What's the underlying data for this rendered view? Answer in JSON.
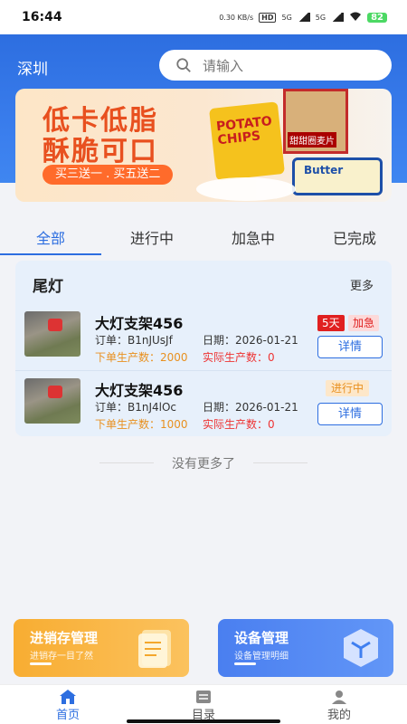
{
  "status_bar": {
    "time": "16:44",
    "speed": "0.30 KB/s",
    "hd": "HD",
    "net1": "5G",
    "net2": "5G",
    "battery": "82"
  },
  "header": {
    "city": "深圳",
    "search_placeholder": "请输入"
  },
  "banner": {
    "line1": "低卡低脂",
    "line2": "酥脆可口",
    "promo": "买三送一 . 买五送二",
    "chips_brand": "POTATO CHIPS",
    "cereal_label": "甜甜圈麦片",
    "butter_label": "Butter"
  },
  "tabs": [
    {
      "label": "全部",
      "active": true
    },
    {
      "label": "进行中",
      "active": false
    },
    {
      "label": "加急中",
      "active": false
    },
    {
      "label": "已完成",
      "active": false
    }
  ],
  "section": {
    "title": "尾灯",
    "more": "更多"
  },
  "orders": [
    {
      "name": "大灯支架456",
      "order_no": "订单：B1nJUsJf",
      "date": "日期：2026-01-21",
      "planned": "下单生产数：2000",
      "actual": "实际生产数：0",
      "badge_days": "5天",
      "badge_status": "加急",
      "detail": "详情"
    },
    {
      "name": "大灯支架456",
      "order_no": "订单：B1nJ4lOc",
      "date": "日期：2026-01-21",
      "planned": "下单生产数：1000",
      "actual": "实际生产数：0",
      "badge_status": "进行中",
      "detail": "详情"
    }
  ],
  "no_more": "没有更多了",
  "tiles": {
    "inventory": {
      "title": "进销存管理",
      "subtitle": "进销存一目了然"
    },
    "device": {
      "title": "设备管理",
      "subtitle": "设备管理明细"
    }
  },
  "nav": [
    {
      "label": "首页",
      "icon": "home-icon",
      "active": true
    },
    {
      "label": "目录",
      "icon": "catalog-icon",
      "active": false
    },
    {
      "label": "我的",
      "icon": "profile-icon",
      "active": false
    }
  ],
  "colors": {
    "primary": "#2d6ee0",
    "orange": "#e8901f",
    "red": "#e02020"
  }
}
